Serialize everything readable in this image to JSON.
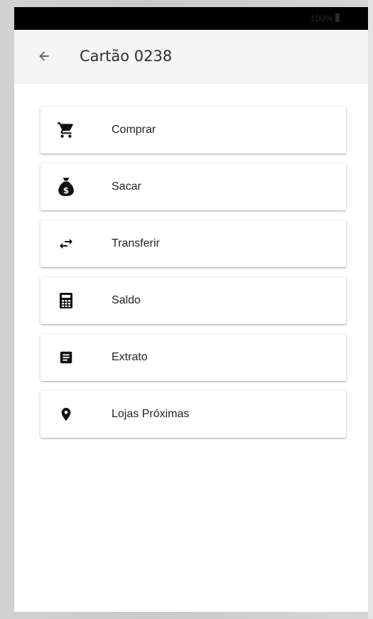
{
  "status_bar": {
    "battery_text": "100%",
    "battery_icon": "battery-icon"
  },
  "header": {
    "back_icon": "arrow-back-icon",
    "title": "Cartão 0238"
  },
  "menu": {
    "items": [
      {
        "label": "Comprar",
        "icon": "shopping-cart-icon"
      },
      {
        "label": "Sacar",
        "icon": "money-bag-icon"
      },
      {
        "label": "Transferir",
        "icon": "transfer-arrows-icon"
      },
      {
        "label": "Saldo",
        "icon": "calculator-icon"
      },
      {
        "label": "Extrato",
        "icon": "document-icon"
      },
      {
        "label": "Lojas Próximas",
        "icon": "location-pin-icon"
      }
    ]
  },
  "colors": {
    "status_bar": "#000000",
    "app_bar": "#f5f5f5",
    "card": "#ffffff",
    "icon": "#111111",
    "text": "#222222"
  }
}
